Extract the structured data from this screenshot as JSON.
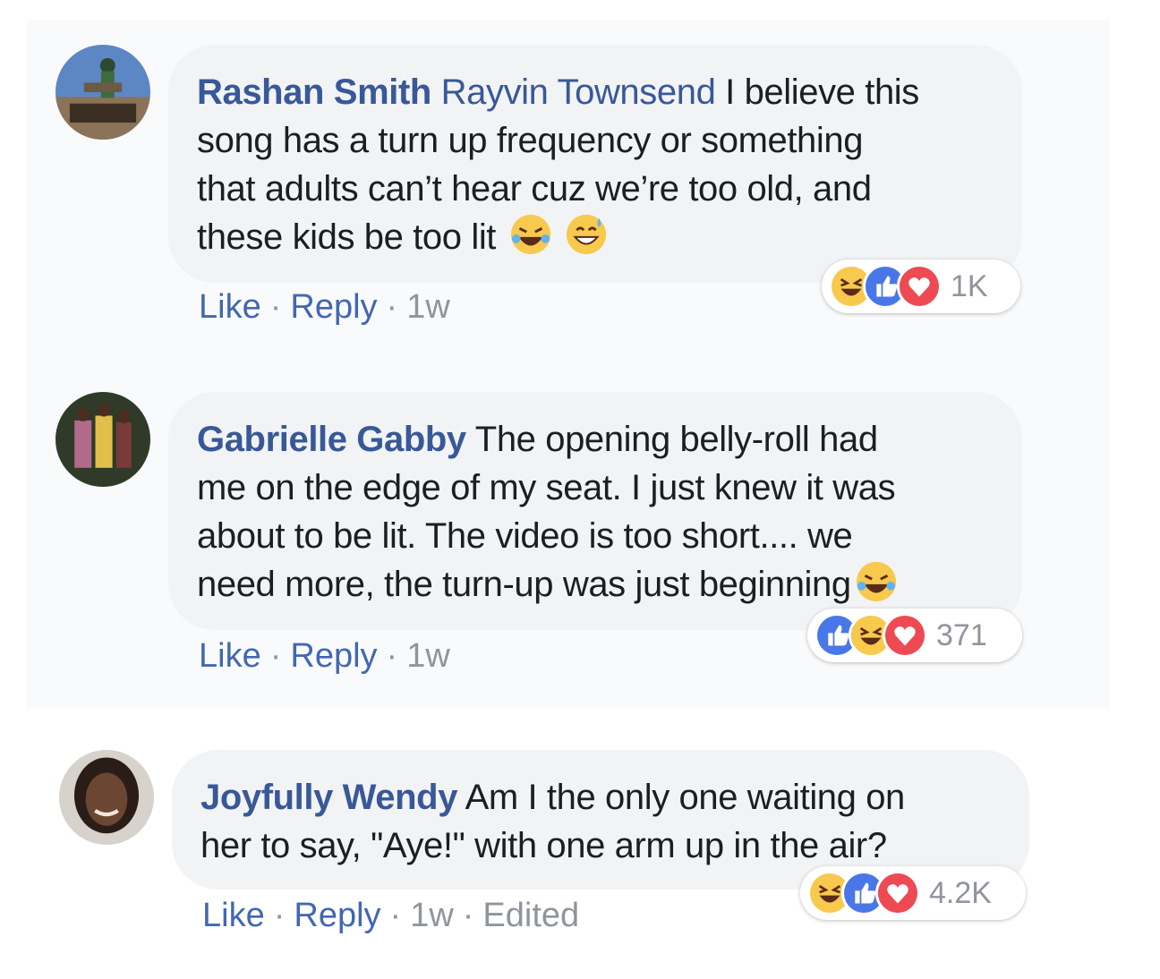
{
  "comments": [
    {
      "author": "Rashan Smith",
      "tag": "Rayvin Townsend",
      "text_lines": [
        "I believe this",
        "song has a turn up frequency or something",
        "that adults can’t hear cuz we’re too old, and",
        "these kids be too lit"
      ],
      "emojis": [
        "tears-of-joy",
        "grinning-sweat"
      ],
      "actions": {
        "like": "Like",
        "reply": "Reply",
        "time": "1w"
      },
      "reactions": [
        "haha",
        "like",
        "love"
      ],
      "reaction_count": "1K"
    },
    {
      "author": "Gabrielle Gabby",
      "text_lines": [
        "The opening belly-roll had",
        "me on the edge of my seat. I just knew it was",
        "about to be lit. The video is too short.... we",
        "need more, the turn-up was just beginning"
      ],
      "emojis": [
        "tears-of-joy"
      ],
      "actions": {
        "like": "Like",
        "reply": "Reply",
        "time": "1w"
      },
      "reactions": [
        "like",
        "haha",
        "love"
      ],
      "reaction_count": "371"
    },
    {
      "author": "Joyfully Wendy",
      "text_lines": [
        "Am I the only one waiting on",
        "her to say, \"Aye!\" with one arm up in the air?"
      ],
      "actions": {
        "like": "Like",
        "reply": "Reply",
        "time": "1w",
        "edited": "Edited"
      },
      "reactions": [
        "haha",
        "like",
        "love"
      ],
      "reaction_count": "4.2K"
    }
  ],
  "colors": {
    "link": "#385898",
    "bubble": "#f2f3f5",
    "meta": "#90949c",
    "like": "#4a77e8",
    "love": "#ee4a54",
    "haha": "#f7c94c"
  }
}
